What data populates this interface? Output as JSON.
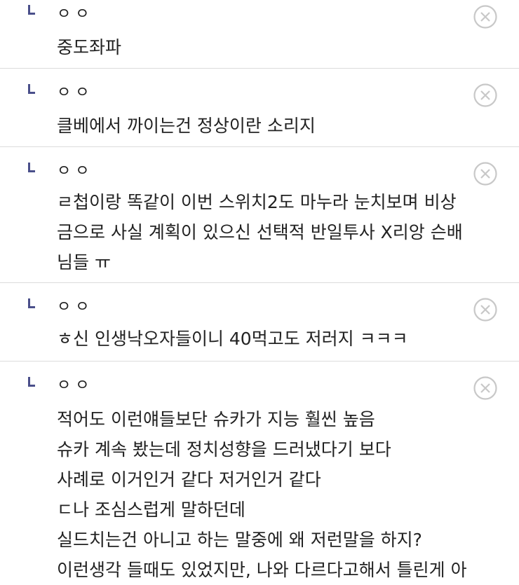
{
  "comments": [
    {
      "author": "ㅇㅇ",
      "lines": [
        "중도좌파"
      ]
    },
    {
      "author": "ㅇㅇ",
      "lines": [
        "클베에서 까이는건 정상이란 소리지"
      ]
    },
    {
      "author": "ㅇㅇ",
      "lines": [
        "ㄹ첩이랑 똑같이 이번 스위치2도 마누라 눈치보며 비상",
        "금으로 사실 계획이 있으신 선택적 반일투사 X리앙 슨배",
        "님들 ㅠ"
      ]
    },
    {
      "author": "ㅇㅇ",
      "lines": [
        "ㅎ신 인생낙오자들이니 40먹고도 저러지 ㅋㅋㅋ"
      ]
    },
    {
      "author": "ㅇㅇ",
      "lines": [
        "적어도 이런얘들보단 슈카가 지능 훨씬 높음",
        "슈카 계속 봤는데 정치성향을 드러냈다기 보다",
        "사례로 이거인거 같다 저거인거 같다",
        "ㄷ나 조심스럽게 말하던데",
        "실드치는건 아니고 하는 말중에 왜 저런말을 하지?",
        "이런생각 들때도 있었지만, 나와 다르다고해서 틀린게 아"
      ]
    }
  ],
  "icons": {
    "reply": "reply-arrow-icon",
    "delete": "close-circle-icon"
  },
  "colors": {
    "reply_icon": "#4a4f8a",
    "delete_icon": "#c8c8c8",
    "divider": "#dcdcdc",
    "text": "#222222"
  }
}
